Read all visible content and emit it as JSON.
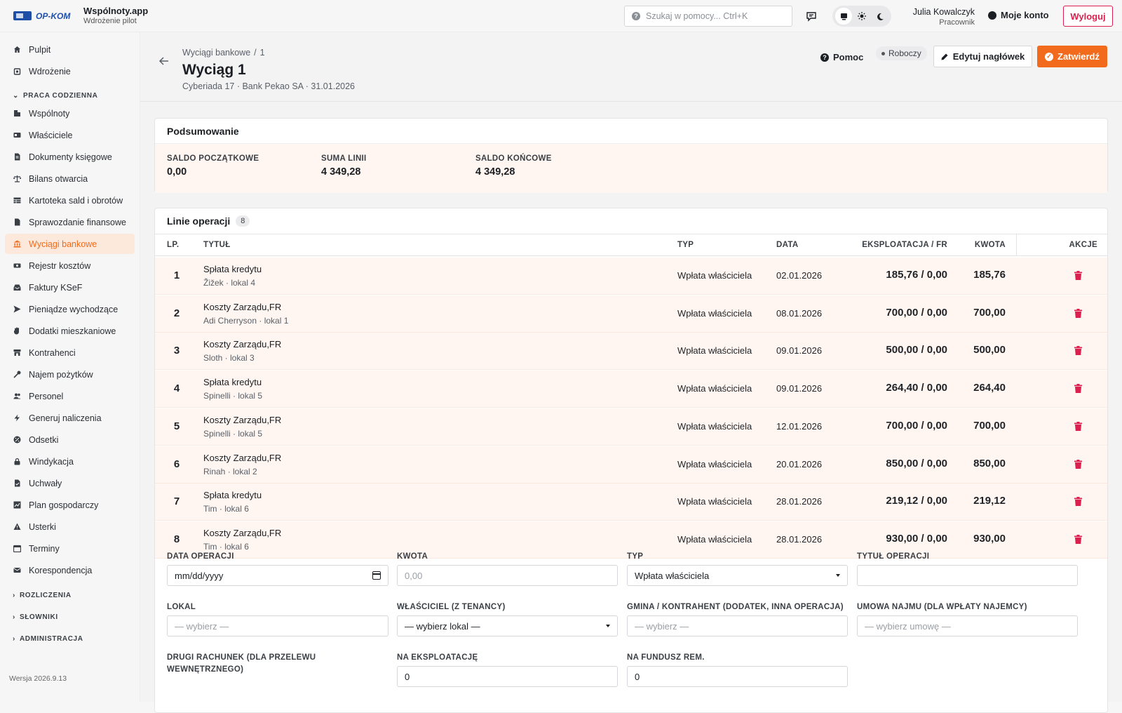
{
  "topbar": {
    "logo_text": "OP-KOM",
    "app_name": "Wspólnoty.app",
    "app_subtitle": "Wdrożenie pilot",
    "search_placeholder": "Szukaj w pomocy... Ctrl+K",
    "user_name": "Julia Kowalczyk",
    "user_role": "Pracownik",
    "account_label": "Moje konto",
    "logout_label": "Wyloguj"
  },
  "sidebar": {
    "top_items": [
      {
        "label": "Pulpit",
        "icon": "home-icon"
      },
      {
        "label": "Wdrożenie",
        "icon": "rocket-icon"
      }
    ],
    "section_daily": "PRACA CODZIENNA",
    "items": [
      {
        "label": "Wspólnoty",
        "icon": "building-icon"
      },
      {
        "label": "Właściciele",
        "icon": "id-card-icon"
      },
      {
        "label": "Dokumenty księgowe",
        "icon": "document-icon"
      },
      {
        "label": "Bilans otwarcia",
        "icon": "scale-icon"
      },
      {
        "label": "Kartoteka sald i obrotów",
        "icon": "table-icon"
      },
      {
        "label": "Sprawozdanie finansowe",
        "icon": "report-icon"
      },
      {
        "label": "Wyciągi bankowe",
        "icon": "bank-icon"
      },
      {
        "label": "Rejestr kosztów",
        "icon": "money-icon"
      },
      {
        "label": "Faktury KSeF",
        "icon": "inbox-icon"
      },
      {
        "label": "Pieniądze wychodzące",
        "icon": "send-icon"
      },
      {
        "label": "Dodatki mieszkaniowe",
        "icon": "hand-icon"
      },
      {
        "label": "Kontrahenci",
        "icon": "store-icon"
      },
      {
        "label": "Najem pożytków",
        "icon": "key-icon"
      },
      {
        "label": "Personel",
        "icon": "users-icon"
      },
      {
        "label": "Generuj naliczenia",
        "icon": "bolt-icon"
      },
      {
        "label": "Odsetki",
        "icon": "percent-icon"
      },
      {
        "label": "Windykacja",
        "icon": "lock-icon"
      },
      {
        "label": "Uchwały",
        "icon": "check-doc-icon"
      },
      {
        "label": "Plan gospodarczy",
        "icon": "chart-icon"
      },
      {
        "label": "Usterki",
        "icon": "warning-icon"
      },
      {
        "label": "Terminy",
        "icon": "calendar-icon"
      },
      {
        "label": "Korespondencja",
        "icon": "mail-icon"
      }
    ],
    "section_settlements": "ROZLICZENIA",
    "section_dictionaries": "SŁOWNIKI",
    "section_admin": "ADMINISTRACJA",
    "version": "Wersja 2026.9.13"
  },
  "header": {
    "breadcrumb_parent": "Wyciągi bankowe",
    "breadcrumb_sep": "/",
    "breadcrumb_current": "1",
    "title": "Wyciąg 1",
    "subtitle": "Cyberiada 17 · Bank Pekao SA · 31.01.2026",
    "help_label": "Pomoc",
    "status_label": "Roboczy",
    "edit_label": "Edytuj nagłówek",
    "approve_label": "Zatwierdź"
  },
  "summary": {
    "title": "Podsumowanie",
    "opening_label": "SALDO POCZĄTKOWE",
    "opening_value": "0,00",
    "lines_label": "SUMA LINII",
    "lines_value": "4 349,28",
    "closing_label": "SALDO KOŃCOWE",
    "closing_value": "4 349,28"
  },
  "operations": {
    "title": "Linie operacji",
    "count": "8",
    "columns": {
      "lp": "LP.",
      "title": "TYTUŁ",
      "type": "TYP",
      "date": "DATA",
      "exploitation": "EKSPLOATACJA / FR",
      "amount": "KWOTA",
      "actions": "AKCJE"
    },
    "rows": [
      {
        "lp": "1",
        "title": "Spłata kredytu",
        "sub": "Žižek · lokal 4",
        "type": "Wpłata właściciela",
        "date": "02.01.2026",
        "exploitation": "185,76 / 0,00",
        "amount": "185,76"
      },
      {
        "lp": "2",
        "title": "Koszty Zarządu,FR",
        "sub": "Adi Cherryson · lokal 1",
        "type": "Wpłata właściciela",
        "date": "08.01.2026",
        "exploitation": "700,00 / 0,00",
        "amount": "700,00"
      },
      {
        "lp": "3",
        "title": "Koszty Zarządu,FR",
        "sub": "Sloth · lokal 3",
        "type": "Wpłata właściciela",
        "date": "09.01.2026",
        "exploitation": "500,00 / 0,00",
        "amount": "500,00"
      },
      {
        "lp": "4",
        "title": "Spłata kredytu",
        "sub": "Spinelli · lokal 5",
        "type": "Wpłata właściciela",
        "date": "09.01.2026",
        "exploitation": "264,40 / 0,00",
        "amount": "264,40"
      },
      {
        "lp": "5",
        "title": "Koszty Zarządu,FR",
        "sub": "Spinelli · lokal 5",
        "type": "Wpłata właściciela",
        "date": "12.01.2026",
        "exploitation": "700,00 / 0,00",
        "amount": "700,00"
      },
      {
        "lp": "6",
        "title": "Koszty Zarządu,FR",
        "sub": "Rinah · lokal 2",
        "type": "Wpłata właściciela",
        "date": "20.01.2026",
        "exploitation": "850,00 / 0,00",
        "amount": "850,00"
      },
      {
        "lp": "7",
        "title": "Spłata kredytu",
        "sub": "Tim · lokal 6",
        "type": "Wpłata właściciela",
        "date": "28.01.2026",
        "exploitation": "219,12 / 0,00",
        "amount": "219,12"
      },
      {
        "lp": "8",
        "title": "Koszty Zarządu,FR",
        "sub": "Tim · lokal 6",
        "type": "Wpłata właściciela",
        "date": "28.01.2026",
        "exploitation": "930,00 / 0,00",
        "amount": "930,00"
      }
    ]
  },
  "form": {
    "date_label": "DATA OPERACJI",
    "date_placeholder": "mm/dd/yyyy",
    "amount_label": "KWOTA",
    "amount_placeholder": "0,00",
    "type_label": "TYP",
    "type_value": "Wpłata właściciela",
    "title_label": "TYTUŁ OPERACJI",
    "title_value": "",
    "unit_label": "LOKAL",
    "unit_placeholder": "— wybierz —",
    "owner_label": "WŁAŚCICIEL (Z TENANCY)",
    "owner_value": "— wybierz lokal —",
    "contractor_label": "GMINA / KONTRAHENT (DODATEK, INNA OPERACJA)",
    "contractor_placeholder": "— wybierz —",
    "lease_label": "UMOWA NAJMU (DLA WPŁATY NAJEMCY)",
    "lease_placeholder": "— wybierz umowę —",
    "second_account_label": "DRUGI RACHUNEK (DLA PRZELEWU WEWNĘTRZNEGO)",
    "exploitation_label": "NA EKSPLOATACJĘ",
    "exploitation_value": "0",
    "fund_label": "NA FUNDUSZ REM.",
    "fund_value": "0"
  },
  "colors": {
    "accent": "#f26a1b",
    "danger": "#d9204e",
    "row_bg": "#fff6f1"
  }
}
